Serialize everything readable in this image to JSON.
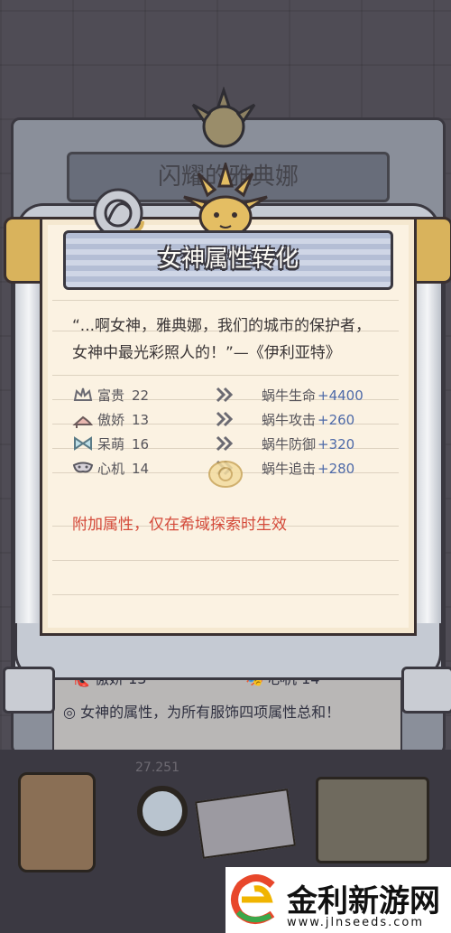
{
  "background": {
    "back_title": "闪耀的雅典娜",
    "back_stats": [
      {
        "label": "傲娇",
        "value": "13"
      },
      {
        "label": "心机",
        "value": "14"
      }
    ],
    "back_note": "女神的属性，为所有服饰四项属性总和！",
    "back_footer_fragment": "27.251"
  },
  "dialog": {
    "title": "女神属性转化",
    "quote_line1": "“...啊女神，雅典娜，我们的城市的保护者，",
    "quote_line2": "女神中最光彩照人的！”—《伊利亚特》",
    "stats": [
      {
        "icon": "crown-icon",
        "label": "富贵",
        "value": "22",
        "snail_label": "蜗牛生命",
        "snail_value": "+4400"
      },
      {
        "icon": "high-heel-icon",
        "label": "傲娇",
        "value": "13",
        "snail_label": "蜗牛攻击",
        "snail_value": "+260"
      },
      {
        "icon": "bow-icon",
        "label": "呆萌",
        "value": "16",
        "snail_label": "蜗牛防御",
        "snail_value": "+320"
      },
      {
        "icon": "mask-icon",
        "label": "心机",
        "value": "14",
        "snail_label": "蜗牛追击",
        "snail_value": "+280"
      }
    ],
    "note": "附加属性，仅在希域探索时生效"
  },
  "watermark": {
    "name": "金利新游网",
    "url": "www.jlnseeds.com"
  },
  "colors": {
    "note_red": "#d44a3a",
    "snail_blue": "#4e6aa8",
    "paper": "#fbf2e2",
    "gold": "#d9b35c"
  }
}
